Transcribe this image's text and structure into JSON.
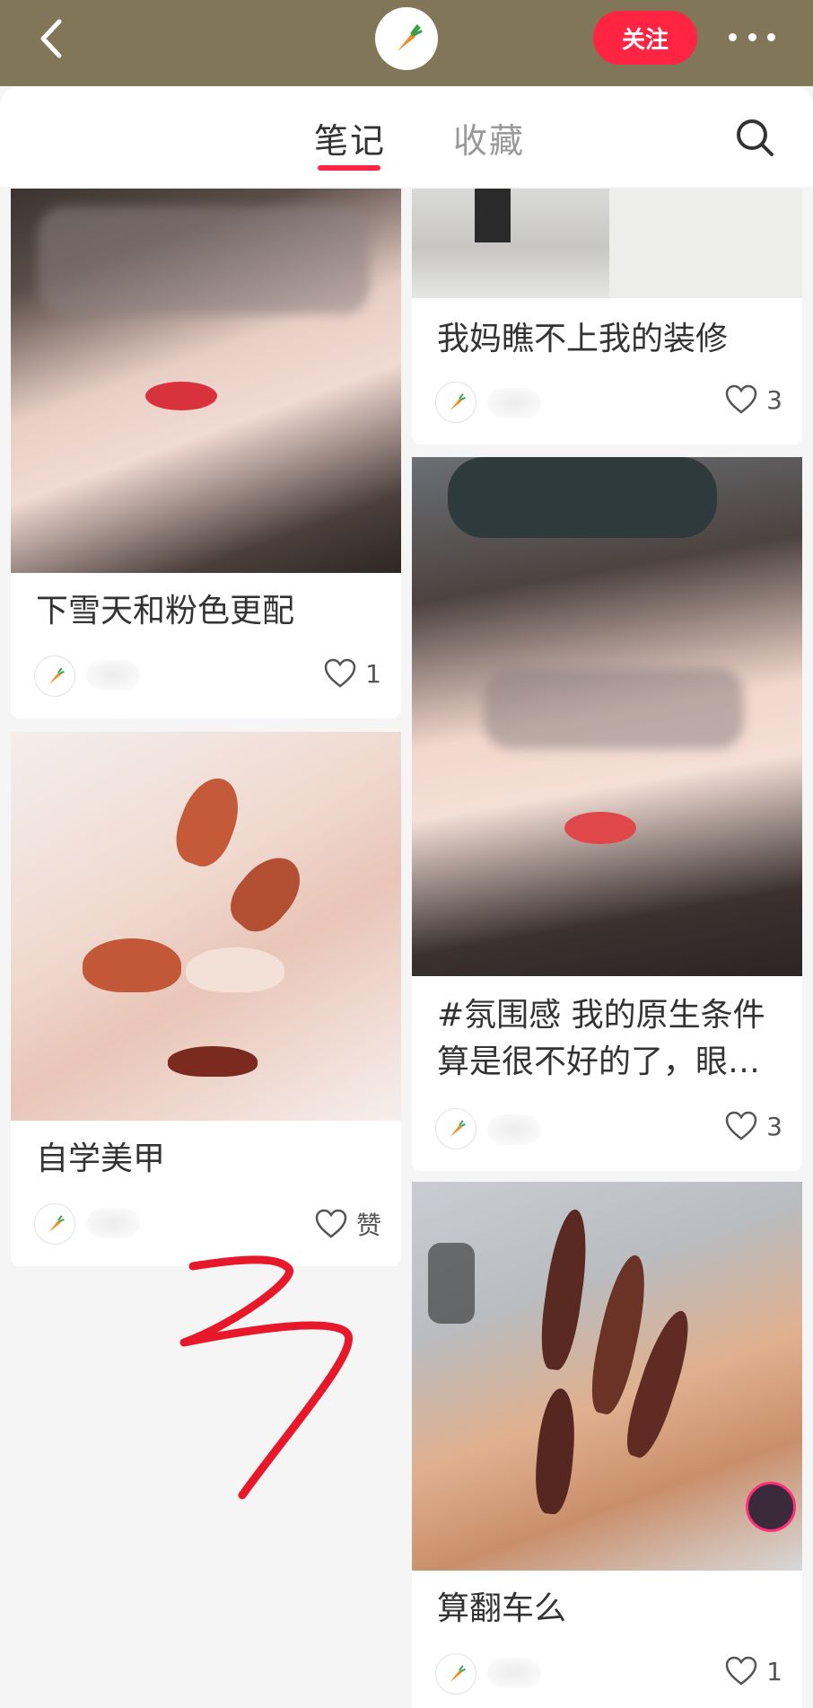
{
  "header": {
    "follow_label": "关注"
  },
  "tabs": {
    "notes": "笔记",
    "favorites": "收藏"
  },
  "cards": {
    "c1": {
      "title": "下雪天和粉色更配",
      "likes": "1"
    },
    "c2": {
      "title": "自学美甲",
      "likes": "赞"
    },
    "c3": {
      "title": "我妈瞧不上我的装修",
      "likes": "3"
    },
    "c4": {
      "title": "#氛围感 我的原生条件算是很不好的了，眼…",
      "likes": "3"
    },
    "c5": {
      "title": "算翻车么",
      "likes": "1"
    }
  },
  "annotation": "3",
  "colors": {
    "topbar": "#827659",
    "accent": "#ff2442",
    "scribble": "#e8182b"
  },
  "icons": {
    "back": "chevron-left-icon",
    "avatar": "carrot-icon",
    "more": "ellipsis-icon",
    "search": "search-icon",
    "like": "heart-outline-icon"
  }
}
